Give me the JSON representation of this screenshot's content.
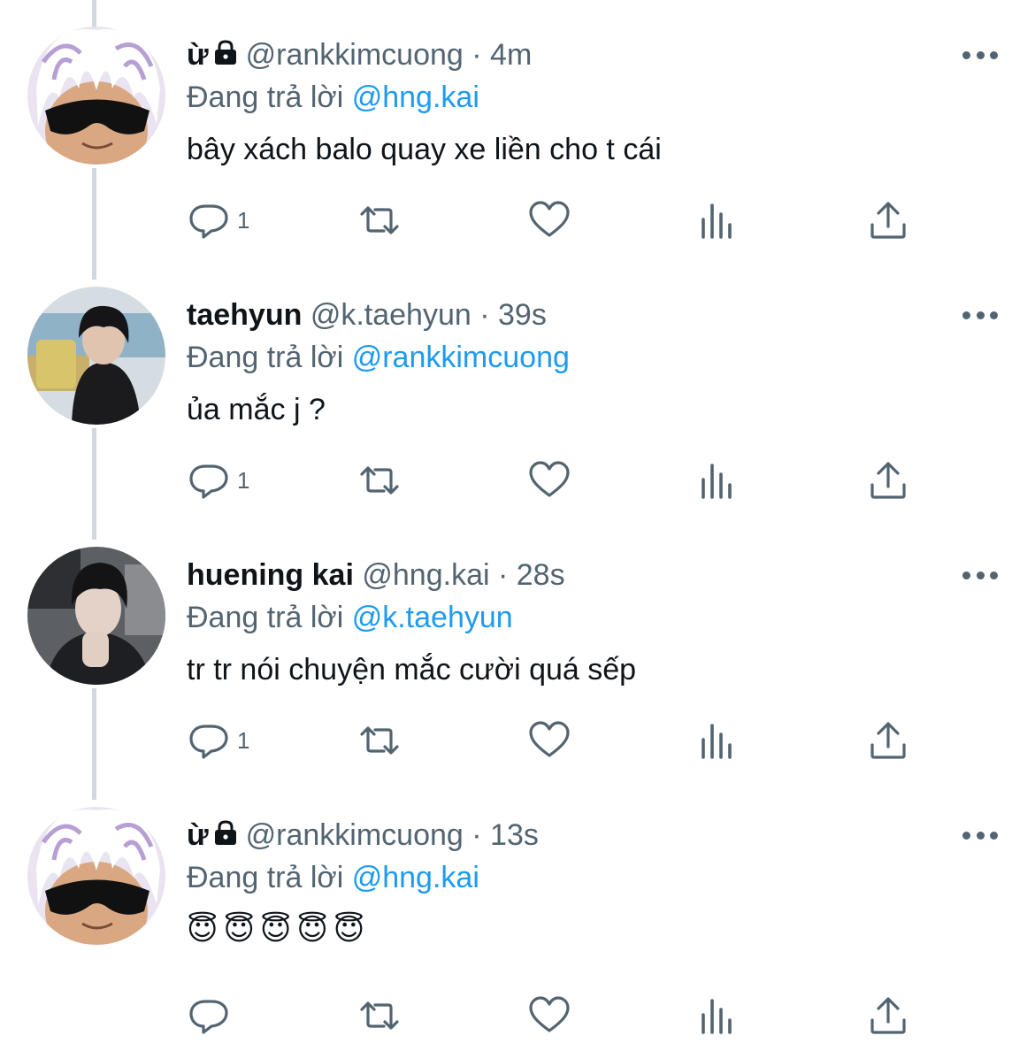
{
  "tweets": [
    {
      "display_name": "ừ",
      "has_lock": true,
      "handle": "@rankkimcuong",
      "dot": "·",
      "time": "4m",
      "replying_prefix": "Đang trả lời",
      "replying_to": "@hng.kai",
      "text": "bây xách balo quay xe liền cho t cái",
      "reply_count": "1",
      "avatar": "white-hair-sunglasses"
    },
    {
      "display_name": "taehyun",
      "has_lock": false,
      "handle": "@k.taehyun",
      "dot": "·",
      "time": "39s",
      "replying_prefix": "Đang trả lời",
      "replying_to": "@rankkimcuong",
      "text": "ủa mắc j ?",
      "reply_count": "1",
      "avatar": "dark-hair-black-coat"
    },
    {
      "display_name": "huening kai",
      "has_lock": false,
      "handle": "@hng.kai",
      "dot": "·",
      "time": "28s",
      "replying_prefix": "Đang trả lời",
      "replying_to": "@k.taehyun",
      "text": "tr tr nói chuyện mắc cười quá sếp",
      "reply_count": "1",
      "avatar": "dark-hair-hoodie"
    },
    {
      "display_name": "ừ",
      "has_lock": true,
      "handle": "@rankkimcuong",
      "dot": "·",
      "time": "13s",
      "replying_prefix": "Đang trả lời",
      "replying_to": "@hng.kai",
      "text": "😇😇😇😇😇",
      "reply_count": "",
      "avatar": "white-hair-sunglasses"
    }
  ],
  "icons": {
    "reply": "reply-icon",
    "retweet": "retweet-icon",
    "like": "heart-icon",
    "views": "analytics-icon",
    "share": "share-icon",
    "more": "more-icon",
    "lock": "lock-icon"
  },
  "colors": {
    "text_primary": "#0f1419",
    "text_secondary": "#536471",
    "mention": "#1d9bf0",
    "thread_line": "#cfd9de"
  }
}
